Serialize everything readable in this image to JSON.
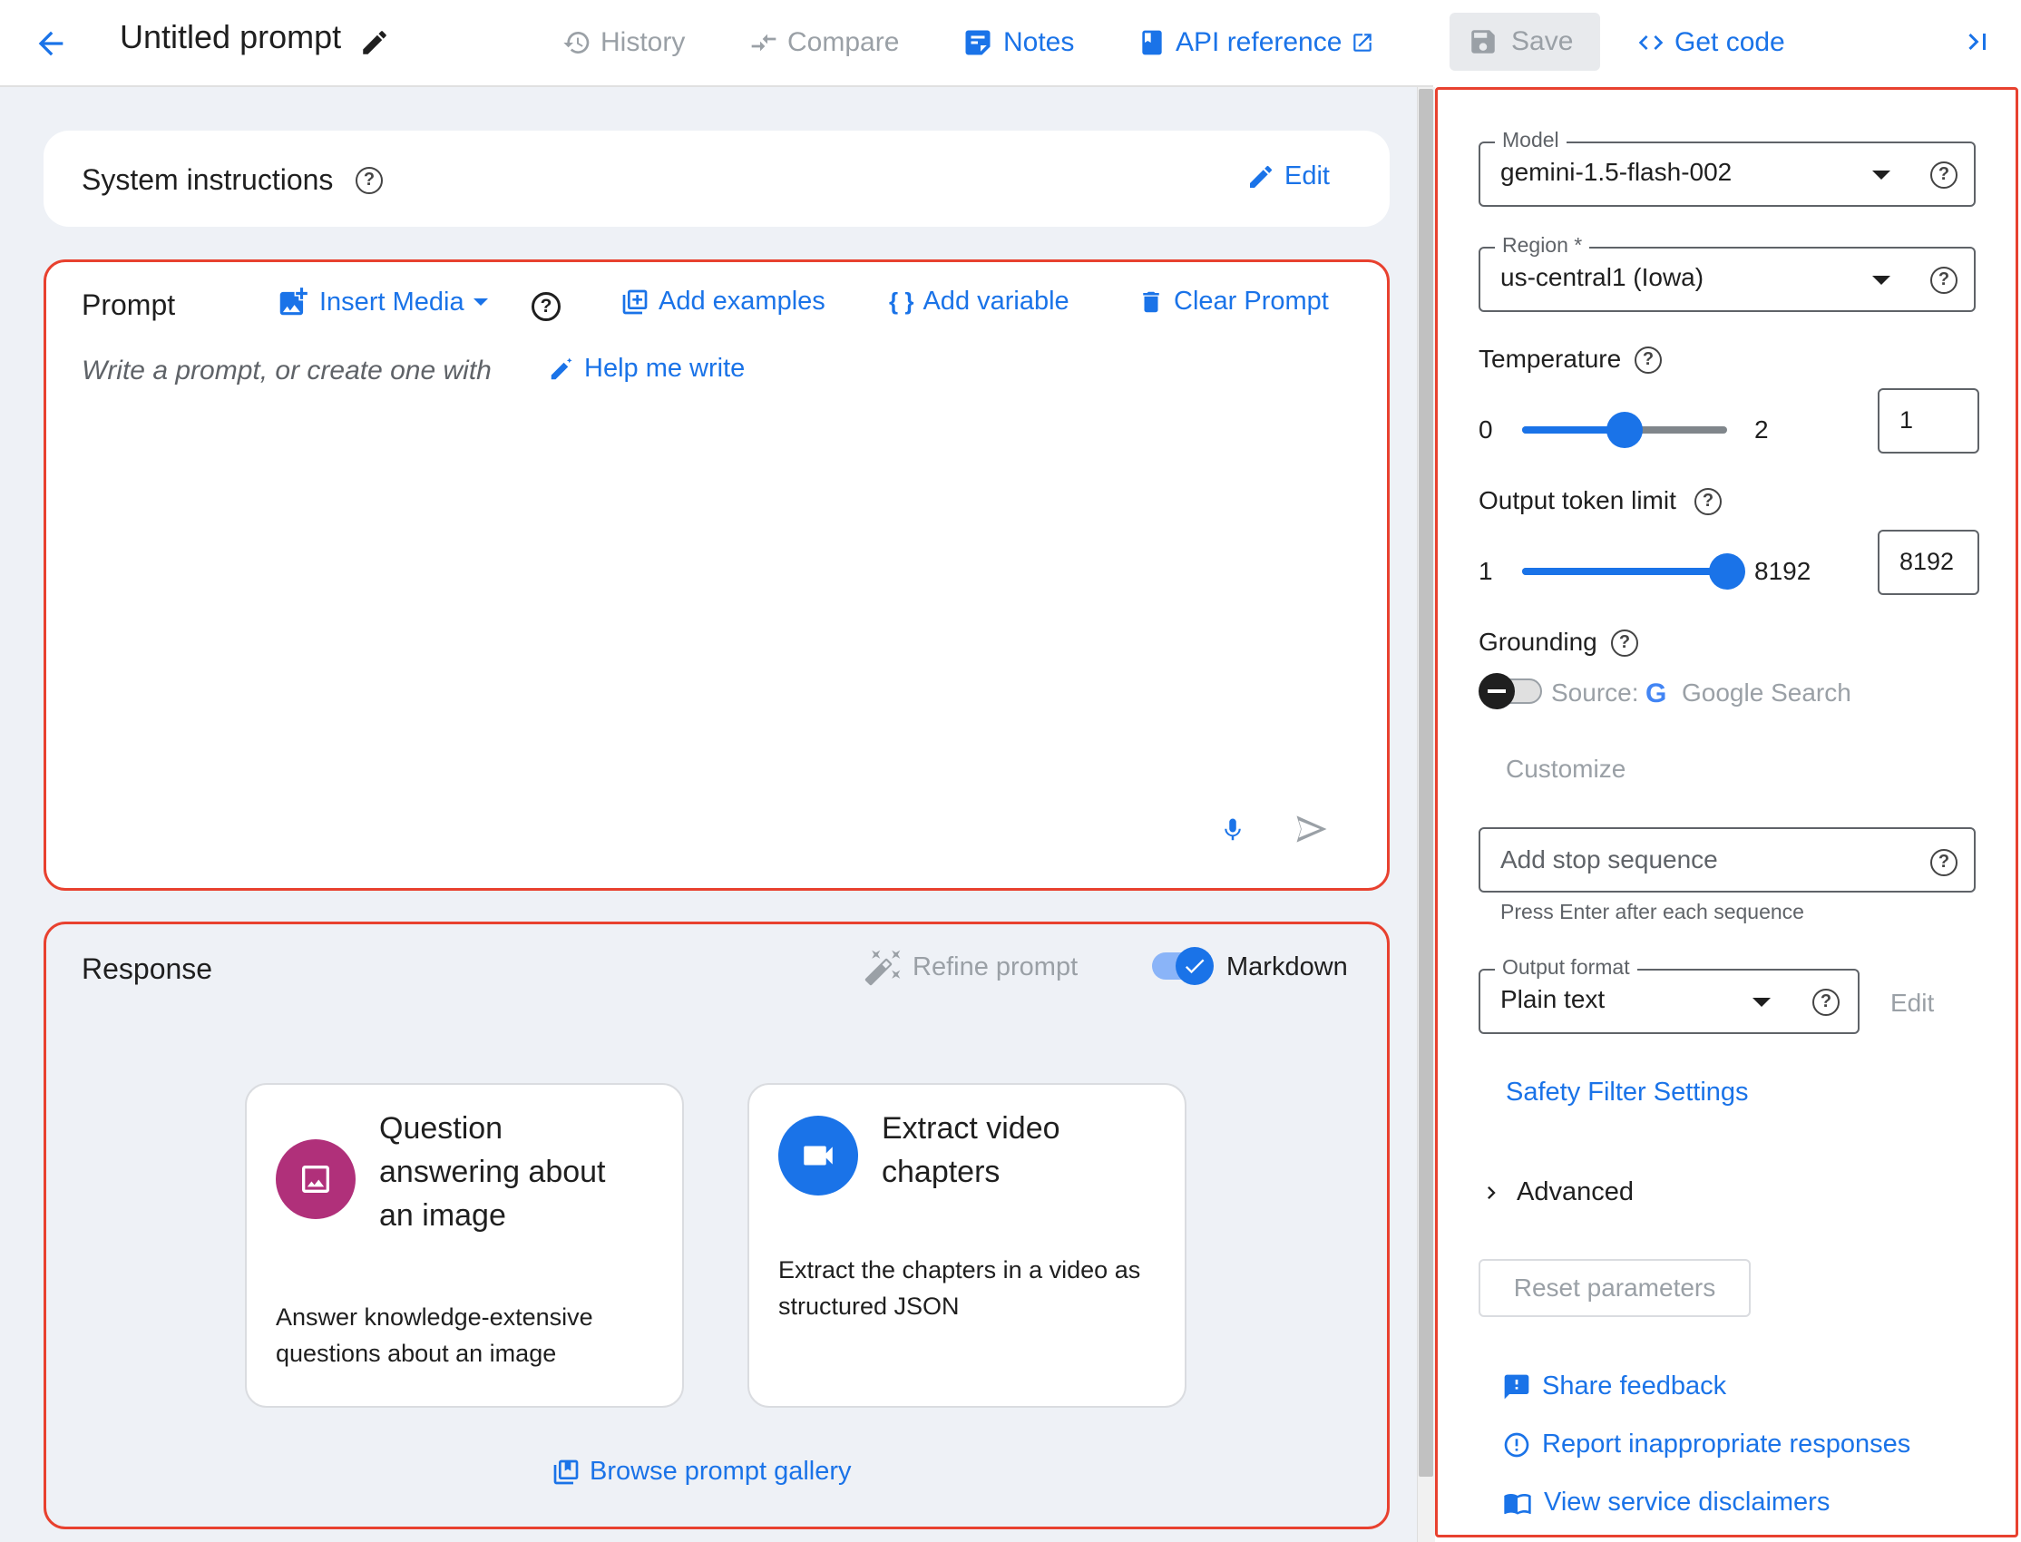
{
  "header": {
    "title": "Untitled prompt",
    "history": "History",
    "compare": "Compare",
    "notes": "Notes",
    "api_reference": "API reference",
    "save": "Save",
    "get_code": "Get code"
  },
  "system_instructions": {
    "label": "System instructions",
    "edit": "Edit"
  },
  "prompt": {
    "label": "Prompt",
    "insert_media": "Insert Media",
    "add_examples": "Add examples",
    "add_variable": "Add variable",
    "clear_prompt": "Clear Prompt",
    "placeholder": "Write a prompt, or create one with",
    "help_me_write": "Help me write"
  },
  "response": {
    "label": "Response",
    "refine_prompt": "Refine prompt",
    "markdown": "Markdown",
    "markdown_on": true,
    "samples": [
      {
        "title_lines": [
          "Question",
          "answering about",
          "an image"
        ],
        "desc_lines": [
          "Answer knowledge-extensive",
          "questions about an image"
        ],
        "icon": "image-icon",
        "color": "#b0307a"
      },
      {
        "title_lines": [
          "Extract video",
          "chapters"
        ],
        "desc_lines": [
          "Extract the chapters in a video as",
          "structured JSON"
        ],
        "icon": "video-icon",
        "color": "#1a73e8"
      }
    ],
    "browse_gallery": "Browse prompt gallery"
  },
  "settings": {
    "model": {
      "label": "Model",
      "value": "gemini-1.5-flash-002"
    },
    "region": {
      "label": "Region *",
      "value": "us-central1 (Iowa)"
    },
    "temperature": {
      "label": "Temperature",
      "min": "0",
      "max": "2",
      "value": "1",
      "fraction": 0.5
    },
    "output_token_limit": {
      "label": "Output token limit",
      "min": "1",
      "max": "8192",
      "value": "8192",
      "fraction": 1.0
    },
    "grounding": {
      "label": "Grounding",
      "source_prefix": "Source:",
      "source": "Google Search",
      "enabled": false,
      "customize": "Customize"
    },
    "stop_sequence": {
      "placeholder": "Add stop sequence",
      "hint": "Press Enter after each sequence"
    },
    "output_format": {
      "label": "Output format",
      "value": "Plain text",
      "edit": "Edit"
    },
    "safety_filter": "Safety Filter Settings",
    "advanced": "Advanced",
    "reset": "Reset parameters",
    "share_feedback": "Share feedback",
    "report": "Report inappropriate responses",
    "disclaimers": "View service disclaimers"
  },
  "colors": {
    "accent": "#1a73e8",
    "highlight_frame": "#e8412f",
    "image_sample": "#b0307a"
  }
}
